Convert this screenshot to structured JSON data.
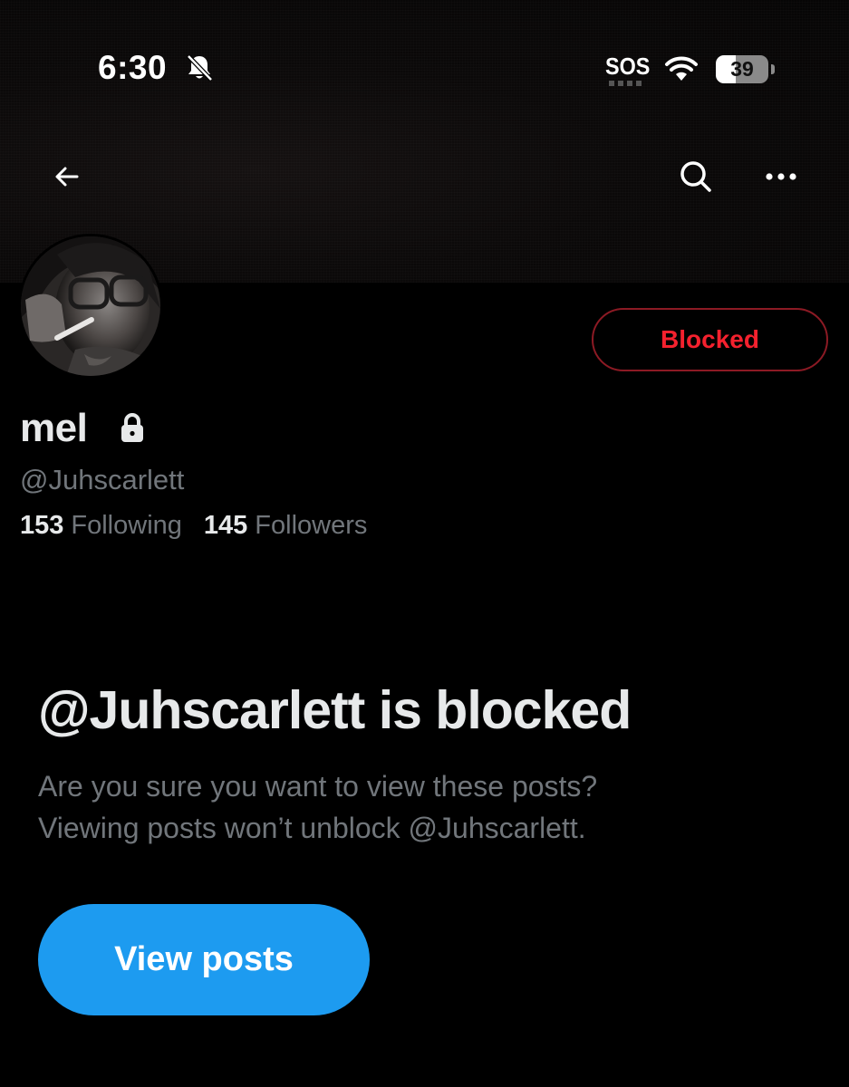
{
  "status_bar": {
    "time": "6:30",
    "sos": "SOS",
    "battery": "39"
  },
  "profile": {
    "display_name": "mel",
    "handle": "@Juhscarlett",
    "following_count": "153",
    "following_label": "Following",
    "followers_count": "145",
    "followers_label": "Followers",
    "blocked_button": "Blocked"
  },
  "blocked_notice": {
    "title": "@Juhscarlett is blocked",
    "line1": "Are you sure you want to view these posts?",
    "line2": "Viewing posts won’t unblock @Juhscarlett.",
    "view_button": "View posts"
  },
  "icons": {
    "back": "arrow-left-icon",
    "search": "search-icon",
    "more": "more-horizontal-icon",
    "lock": "lock-icon",
    "bell": "bell-slash-icon",
    "wifi": "wifi-icon"
  },
  "colors": {
    "accent": "#1d9bf0",
    "blocked": "#f4212e",
    "background": "#000000",
    "secondary_text": "#71767b"
  }
}
